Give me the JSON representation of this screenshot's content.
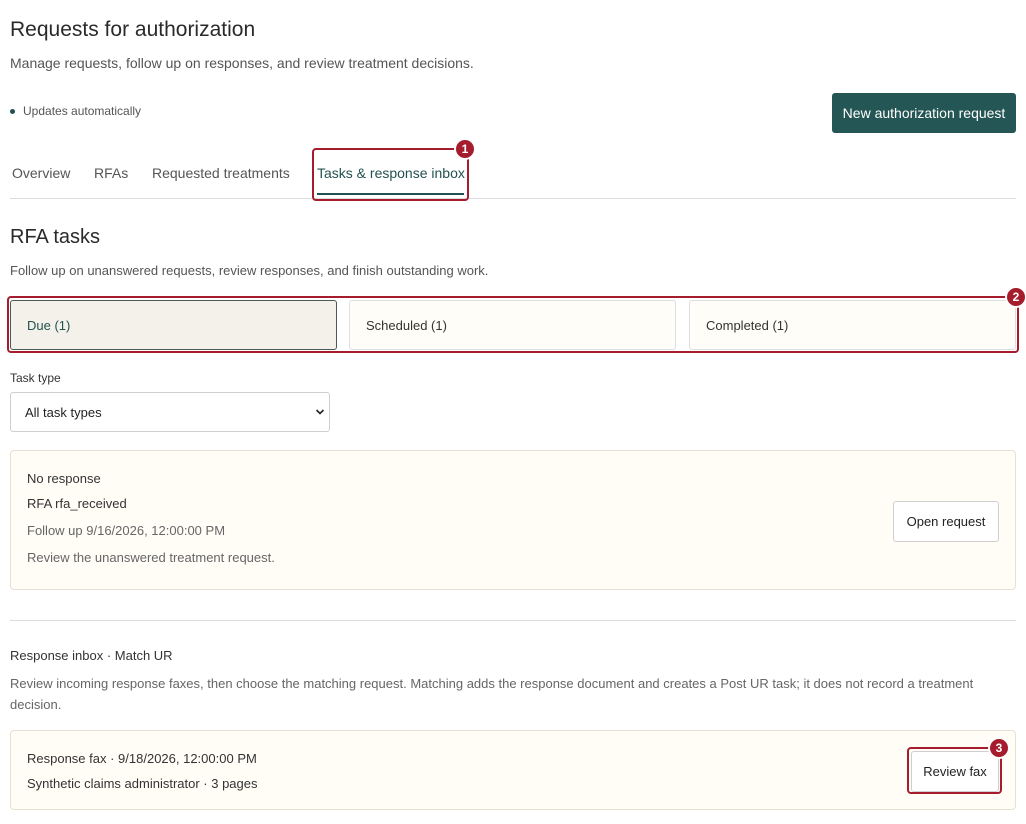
{
  "header": {
    "title": "Requests for authorization",
    "subtitle": "Manage requests, follow up on responses, and review treatment decisions.",
    "status_text": "Updates automatically",
    "new_request_label": "New authorization request"
  },
  "tabs": [
    {
      "label": "Overview"
    },
    {
      "label": "RFAs"
    },
    {
      "label": "Requested treatments"
    },
    {
      "label": "Tasks & response inbox",
      "active": true
    }
  ],
  "annotations": [
    "1",
    "2",
    "3"
  ],
  "tasks": {
    "title": "RFA tasks",
    "subtitle": "Follow up on unanswered requests, review responses, and finish outstanding work.",
    "filters": [
      {
        "label": "Due (1)",
        "active": true
      },
      {
        "label": "Scheduled (1)"
      },
      {
        "label": "Completed (1)"
      }
    ],
    "task_type_label": "Task type",
    "task_type_value": "All task types",
    "items": [
      {
        "title": "No response",
        "rfa": "RFA rfa_received",
        "follow_up": "Follow up 9/16/2026, 12:00:00 PM",
        "description": "Review the unanswered treatment request.",
        "action_label": "Open request"
      }
    ]
  },
  "inbox": {
    "title": "Response inbox · Match UR",
    "description": "Review incoming response faxes, then choose the matching request. Matching adds the response document and creates a Post UR task; it does not record a treatment decision.",
    "items": [
      {
        "title": "Response fax · 9/18/2026, 12:00:00 PM",
        "meta": "Synthetic claims administrator · 3 pages",
        "action_label": "Review fax"
      }
    ]
  },
  "colors": {
    "brand": "#235654",
    "annotation": "#a51d2d"
  }
}
